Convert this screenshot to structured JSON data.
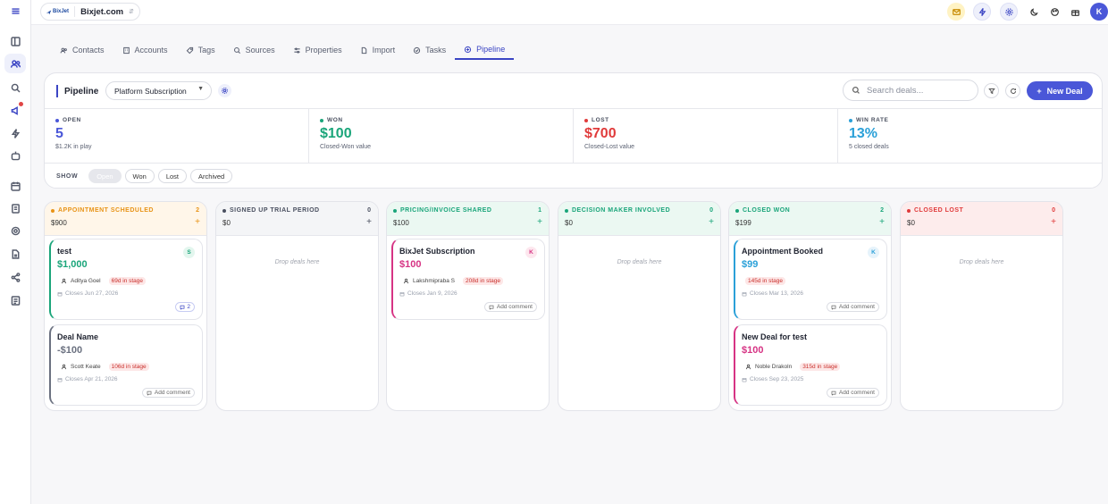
{
  "app": {
    "workspace_name": "Bixjet.com",
    "logo_text": "BixJet",
    "user_initial": "K"
  },
  "tabs": [
    {
      "label": "Contacts",
      "icon": "users-icon"
    },
    {
      "label": "Accounts",
      "icon": "building-icon"
    },
    {
      "label": "Tags",
      "icon": "tag-icon"
    },
    {
      "label": "Sources",
      "icon": "search-icon"
    },
    {
      "label": "Properties",
      "icon": "sliders-icon"
    },
    {
      "label": "Import",
      "icon": "file-icon"
    },
    {
      "label": "Tasks",
      "icon": "check-circle-icon"
    },
    {
      "label": "Pipeline",
      "icon": "pipeline-icon",
      "active": true
    }
  ],
  "pipeline": {
    "title": "Pipeline",
    "selected": "Platform Subscription",
    "search_placeholder": "Search deals...",
    "new_deal_label": "New Deal"
  },
  "stats": [
    {
      "label": "OPEN",
      "value": "5",
      "sub": "$1.2K in play",
      "color": "#4a57d8"
    },
    {
      "label": "WON",
      "value": "$100",
      "sub": "Closed-Won value",
      "color": "#1aa57a"
    },
    {
      "label": "LOST",
      "value": "$700",
      "sub": "Closed-Lost value",
      "color": "#e03b3b"
    },
    {
      "label": "WIN RATE",
      "value": "13%",
      "sub": "5 closed deals",
      "color": "#2aa0d8"
    }
  ],
  "show": {
    "label": "SHOW",
    "options": [
      "Open",
      "Won",
      "Lost",
      "Archived"
    ],
    "selected": "Open"
  },
  "columns": [
    {
      "name": "APPOINTMENT SCHEDULED",
      "count": "2",
      "total": "$900",
      "color": "#e89316",
      "bg": "#fff6e9",
      "cards": [
        {
          "title": "test",
          "amount": "$1,000",
          "amount_color": "#1aa57a",
          "border": "#1aa57a",
          "avatar": "S",
          "avatar_bg": "#e3f6ee",
          "avatar_fg": "#1aa57a",
          "owner": "Aditya Goel",
          "stage": "69d in stage",
          "closes": "Closes Jun 27, 2026",
          "comments": "2"
        },
        {
          "title": "Deal Name",
          "amount": "-$100",
          "amount_color": "#6b7180",
          "border": "#6b7180",
          "owner": "Scott Keate",
          "stage": "106d in stage",
          "closes": "Closes Apr 21, 2026",
          "add_comment": "Add comment"
        }
      ]
    },
    {
      "name": "SIGNED UP TRIAL PERIOD",
      "count": "0",
      "total": "$0",
      "color": "#4a5060",
      "bg": "#f4f5f7",
      "drop": "Drop deals here",
      "cards": []
    },
    {
      "name": "PRICING/INVOICE SHARED",
      "count": "1",
      "total": "$100",
      "color": "#1aa57a",
      "bg": "#ebf8f2",
      "cards": [
        {
          "title": "BixJet Subscription",
          "amount": "$100",
          "amount_color": "#d63384",
          "border": "#d63384",
          "avatar": "K",
          "avatar_bg": "#fde7ee",
          "avatar_fg": "#d63384",
          "owner": "Lakshmipraba S",
          "stage": "208d in stage",
          "closes": "Closes Jan 9, 2026",
          "add_comment": "Add comment"
        }
      ]
    },
    {
      "name": "DECISION MAKER INVOLVED",
      "count": "0",
      "total": "$0",
      "color": "#1aa57a",
      "bg": "#ebf8f2",
      "drop": "Drop deals here",
      "cards": []
    },
    {
      "name": "CLOSED WON",
      "count": "2",
      "total": "$199",
      "color": "#1aa57a",
      "bg": "#ebf8f2",
      "cards": [
        {
          "title": "Appointment Booked",
          "amount": "$99",
          "amount_color": "#2aa0d8",
          "border": "#2aa0d8",
          "avatar": "K",
          "avatar_bg": "#e6f3fb",
          "avatar_fg": "#2aa0d8",
          "stage": "145d in stage",
          "closes": "Closes Mar 13, 2026",
          "add_comment": "Add comment"
        },
        {
          "title": "New Deal for test",
          "amount": "$100",
          "amount_color": "#d63384",
          "border": "#d63384",
          "owner": "Noble Drakoln",
          "stage": "315d in stage",
          "closes": "Closes Sep 23, 2025",
          "add_comment": "Add comment"
        }
      ]
    },
    {
      "name": "CLOSED LOST",
      "count": "0",
      "total": "$0",
      "color": "#e03b3b",
      "bg": "#fdecec",
      "drop": "Drop deals here",
      "cards": []
    }
  ]
}
